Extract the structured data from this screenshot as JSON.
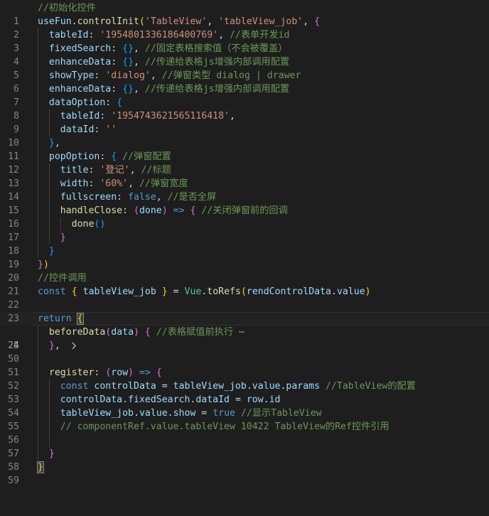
{
  "editor": {
    "line_numbers": [
      "1",
      "2",
      "3",
      "4",
      "5",
      "6",
      "7",
      "8",
      "9",
      "10",
      "11",
      "12",
      "13",
      "14",
      "15",
      "16",
      "17",
      "18",
      "19",
      "20",
      "21",
      "22",
      "23",
      "24",
      "25",
      "50",
      "51",
      "52",
      "53",
      "54",
      "55",
      "56",
      "57",
      "58",
      "59"
    ],
    "fold_icon": "chevron-right-icon",
    "current_line": "24",
    "folded_line": "25",
    "ellipsis": "⋯"
  },
  "code": {
    "l1_comment": "//初始化控件",
    "l2_obj": "useFun",
    "l2_fn": "controlInit",
    "l2_arg1": "'TableView'",
    "l2_arg2": "'tableView_job'",
    "l3_key": "tableId",
    "l3_val": "'1954801336186400769'",
    "l3_comment": "//表单开发id",
    "l4_key": "fixedSearch",
    "l4_comment": "//固定表格搜索值（不会被覆盖）",
    "l5_key": "enhanceData",
    "l5_comment": "//传递给表格js增强内部调用配置",
    "l6_key": "showType",
    "l6_val": "'dialog'",
    "l6_comment": "//弹窗类型 dialog | drawer",
    "l7_key": "enhanceData",
    "l7_comment": "//传递给表格js增强内部调用配置",
    "l8_key": "dataOption",
    "l9_key": "tableId",
    "l9_val": "'1954743621565116418'",
    "l10_key": "dataId",
    "l10_val": "''",
    "l12_key": "popOption",
    "l12_comment": "//弹窗配置",
    "l13_key": "title",
    "l13_val": "'登记'",
    "l13_comment": "//标题",
    "l14_key": "width",
    "l14_val": "'60%'",
    "l14_comment": "//弹窗宽度",
    "l15_key": "fullscreen",
    "l15_val": "false",
    "l15_comment": "//是否全屏",
    "l16_key": "handleClose",
    "l16_param": "done",
    "l16_comment": "//关闭弹窗前的回调",
    "l17_fn": "done",
    "l21_comment": "//控件调用",
    "l22_const": "const",
    "l22_var": "tableView_job",
    "l22_obj": "Vue",
    "l22_fn": "toRefs",
    "l22_arg": "rendControlData",
    "l22_prop": "value",
    "l24_kw": "return",
    "l25_fn": "beforeData",
    "l25_param": "data",
    "l25_comment": "//表格赋值前执行",
    "l51_fn": "register",
    "l51_param": "row",
    "l52_const": "const",
    "l52_var": "controlData",
    "l52_src": "tableView_job",
    "l52_p1": "value",
    "l52_p2": "params",
    "l52_comment": "//TableView的配置",
    "l53_obj": "controlData",
    "l53_p1": "fixedSearch",
    "l53_p2": "dataId",
    "l53_src": "row",
    "l53_p3": "id",
    "l54_obj": "tableView_job",
    "l54_p1": "value",
    "l54_p2": "show",
    "l54_val": "true",
    "l54_comment": "//显示TableView",
    "l55_comment": "// componentRef.value.tableView 10422 TableView的Ref控件引用"
  }
}
